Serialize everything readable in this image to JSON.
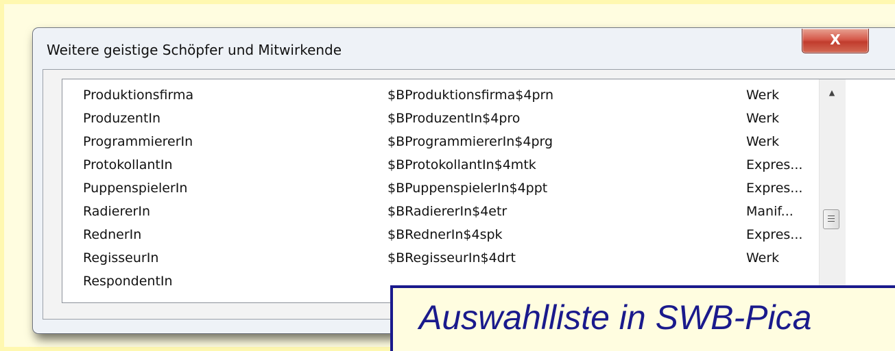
{
  "dialog": {
    "title": "Weitere geistige Schöpfer und Mitwirkende",
    "close_label": "X"
  },
  "list": {
    "rows": [
      {
        "name": "Produktionsfirma",
        "code": "$BProduktionsfirma$4prn",
        "level": "Werk"
      },
      {
        "name": "ProduzentIn",
        "code": "$BProduzentIn$4pro",
        "level": "Werk"
      },
      {
        "name": "ProgrammiererIn",
        "code": "$BProgrammiererIn$4prg",
        "level": "Werk"
      },
      {
        "name": "ProtokollantIn",
        "code": "$BProtokollantIn$4mtk",
        "level": "Expres..."
      },
      {
        "name": "PuppenspielerIn",
        "code": "$BPuppenspielerIn$4ppt",
        "level": "Expres..."
      },
      {
        "name": "RadiererIn",
        "code": "$BRadiererIn$4etr",
        "level": "Manif..."
      },
      {
        "name": "RednerIn",
        "code": "$BRednerIn$4spk",
        "level": "Expres..."
      },
      {
        "name": "RegisseurIn",
        "code": "$BRegisseurIn$4drt",
        "level": "Werk"
      },
      {
        "name": "RespondentIn",
        "code": "",
        "level": ""
      }
    ]
  },
  "scrollbar": {
    "up_icon": "▲"
  },
  "caption": "Auswahlliste in SWB-Pica"
}
